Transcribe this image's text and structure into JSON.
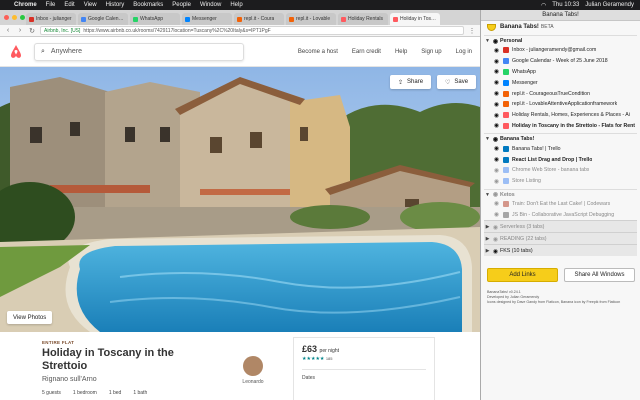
{
  "menubar": {
    "app": "Chrome",
    "items": [
      "File",
      "Edit",
      "View",
      "History",
      "Bookmarks",
      "People",
      "Window",
      "Help"
    ],
    "clock": "Thu 10:33",
    "user": "Julian Geramendy"
  },
  "browser": {
    "tabs": [
      {
        "label": "Inbox - julianger",
        "color": "#d93025"
      },
      {
        "label": "Google Calendar",
        "color": "#4285f4"
      },
      {
        "label": "WhatsApp",
        "color": "#25d366"
      },
      {
        "label": "Messenger",
        "color": "#0084ff"
      },
      {
        "label": "repl.it - Coura",
        "color": "#f26207"
      },
      {
        "label": "repl.it - Lovable",
        "color": "#f26207"
      },
      {
        "label": "Holiday Rentals",
        "color": "#ff5a5f"
      },
      {
        "label": "Holiday in Toscan",
        "color": "#ff5a5f"
      }
    ],
    "url_secure": "Airbnb, Inc. [US]",
    "url": "https://www.airbnb.co.uk/rooms/7429117location=Tuscany%2C%20Italy&s=IPT1PgF"
  },
  "airbnb": {
    "search_placeholder": "Anywhere",
    "nav": [
      "Become a host",
      "Earn credit",
      "Help",
      "Sign up",
      "Log in"
    ],
    "share_label": "Share",
    "save_label": "Save",
    "view_photos_label": "View Photos",
    "listing_type": "ENTIRE FLAT",
    "title": "Holiday in Toscany in the Strettoio",
    "location": "Rignano sull'Arno",
    "facts": [
      "5 guests",
      "1 bedroom",
      "1 bed",
      "1 bath"
    ],
    "host_name": "Leonardo",
    "price": "£63",
    "price_unit": "per night",
    "stars": "★★★★★",
    "review_count": "185",
    "dates_label": "Dates"
  },
  "banana_tabs": {
    "window_title": "Banana Tabs!",
    "header": "Banana Tabs!",
    "header_badge": "BETA",
    "groups": [
      {
        "name": "Personal",
        "collapsed": false,
        "tabs": [
          {
            "title": "Inbox - juliangeramendy@gmail.com",
            "color": "#d93025"
          },
          {
            "title": "Google Calendar - Week of 25 June 2018",
            "color": "#4285f4"
          },
          {
            "title": "WhatsApp",
            "color": "#25d366"
          },
          {
            "title": "Messenger",
            "color": "#0084ff"
          },
          {
            "title": "repl.it - CourageousTrueCondition",
            "color": "#f26207"
          },
          {
            "title": "repl.it - LovableAttentiveApplicationframework",
            "color": "#f26207"
          },
          {
            "title": "Holiday Rentals, Homes, Experiences & Places - Ai",
            "color": "#ff5a5f"
          },
          {
            "title": "Holiday in Toscany in the Strettoio - Flats for Rent",
            "color": "#ff5a5f",
            "active": true
          }
        ]
      },
      {
        "name": "Banana Tabs!",
        "collapsed": false,
        "tabs": [
          {
            "title": "Banana Tabs! | Trello",
            "color": "#0079bf"
          },
          {
            "title": "React List Drag and Drop | Trello",
            "color": "#0079bf",
            "active": true
          },
          {
            "title": "Chrome Web Store - banana tabs",
            "color": "#4285f4",
            "dim": true
          },
          {
            "title": "Store Listing",
            "color": "#4285f4",
            "dim": true
          }
        ]
      },
      {
        "name": "Ketos",
        "collapsed": false,
        "dim": true,
        "tabs": [
          {
            "title": "Train: Don't Eat the Last Cake! | Codewars",
            "color": "#b1361e",
            "dim": true
          },
          {
            "title": "JS Bin - Collaborative JavaScript Debugging",
            "color": "#555555",
            "dim": true
          }
        ]
      },
      {
        "name": "Serverless (3 tabs)",
        "collapsed": true,
        "dim": true
      },
      {
        "name": "READING (22 tabs)",
        "collapsed": true,
        "dim": true
      },
      {
        "name": "FKS (10 tabs)",
        "collapsed": true,
        "dim": false
      }
    ],
    "add_links_label": "Add Links",
    "share_all_label": "Share All Windows",
    "footer": [
      "BananaTabs! v0.24.1",
      "Developed by Julian Geramendy",
      "Icons designed by Dave Gandy from Flaticon, Banana icon by Freepik from Flaticon"
    ]
  }
}
